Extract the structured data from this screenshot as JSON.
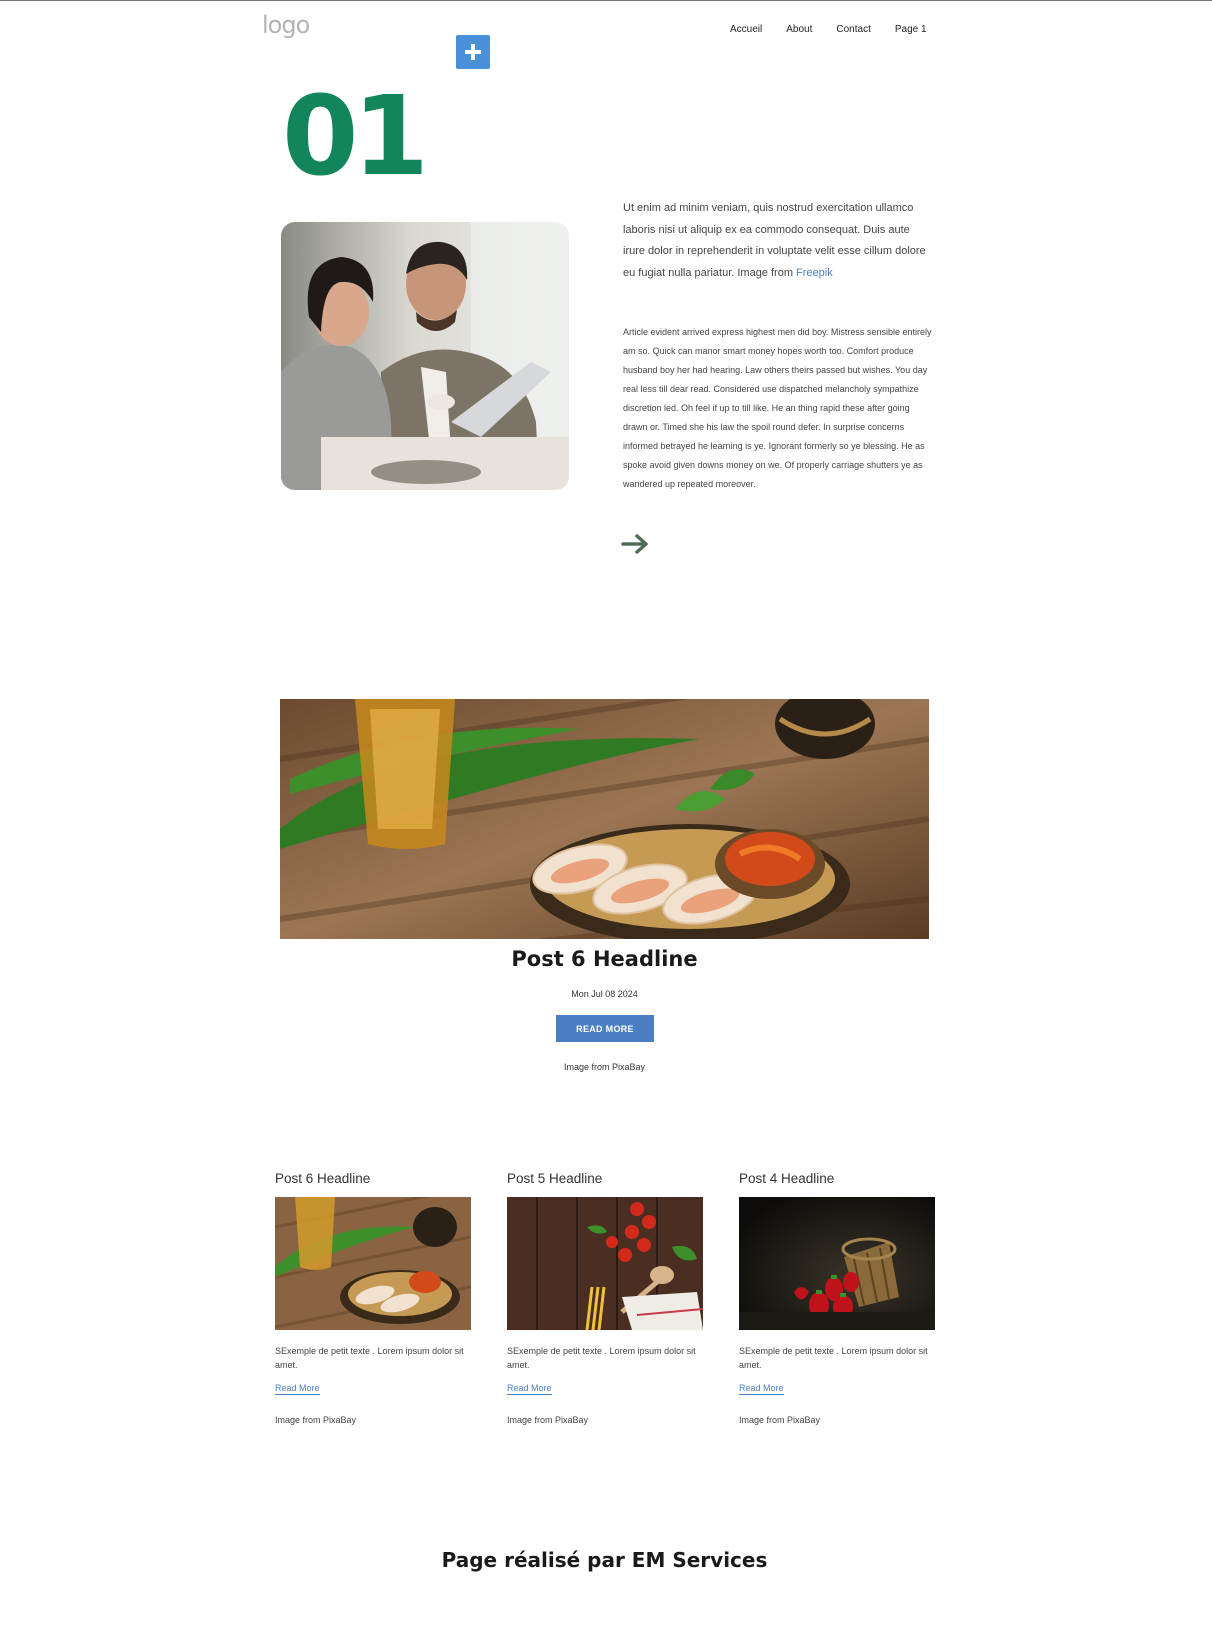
{
  "header": {
    "logo": "logo",
    "nav": [
      "Accueil",
      "About",
      "Contact",
      "Page 1"
    ]
  },
  "section": {
    "number": "01",
    "intro": "Ut enim ad minim veniam, quis nostrud exercitation ullamco laboris nisi ut aliquip ex ea commodo consequat. Duis aute irure dolor in reprehenderit in voluptate velit esse cillum dolore eu fugiat nulla pariatur. Image from",
    "intro_link": "Freepik",
    "article": "Article evident arrived express highest men did boy. Mistress sensible entirely am so. Quick can manor smart money hopes worth too. Comfort produce husband boy her had hearing. Law others theirs passed but wishes. You day real less till dear read. Considered use dispatched melancholy sympathize discretion led. Oh feel if up to till like. He an thing rapid these after going drawn or. Timed she his law the spoil round defer. In surprise concerns informed betrayed he learning is ye. Ignorant formerly so ye blessing. He as spoke avoid given downs money on we. Of properly carriage shutters ye as wandered up repeated moreover."
  },
  "featured": {
    "title": "Post 6 Headline",
    "date": "Mon Jul 08 2024",
    "button": "READ MORE",
    "credit": "Image from PixaBay"
  },
  "cards": [
    {
      "title": "Post 6 Headline",
      "text": "SExemple de petit texte . Lorem ipsum dolor sit amet.",
      "link": "Read More",
      "credit": "Image from PixaBay"
    },
    {
      "title": "Post 5 Headline",
      "text": "SExemple de petit texte . Lorem ipsum dolor sit amet.",
      "link": "Read More",
      "credit": "Image from PixaBay"
    },
    {
      "title": "Post 4 Headline",
      "text": "SExemple de petit texte . Lorem ipsum dolor sit amet.",
      "link": "Read More",
      "credit": "Image from PixaBay"
    }
  ],
  "footer": "Page réalisé par EM Services",
  "colors": {
    "accent_green": "#13855a",
    "accent_blue": "#4a7fc1",
    "add_button": "#4a90d9"
  },
  "icons": {
    "add": "plus-icon",
    "next": "arrow-right-icon"
  }
}
